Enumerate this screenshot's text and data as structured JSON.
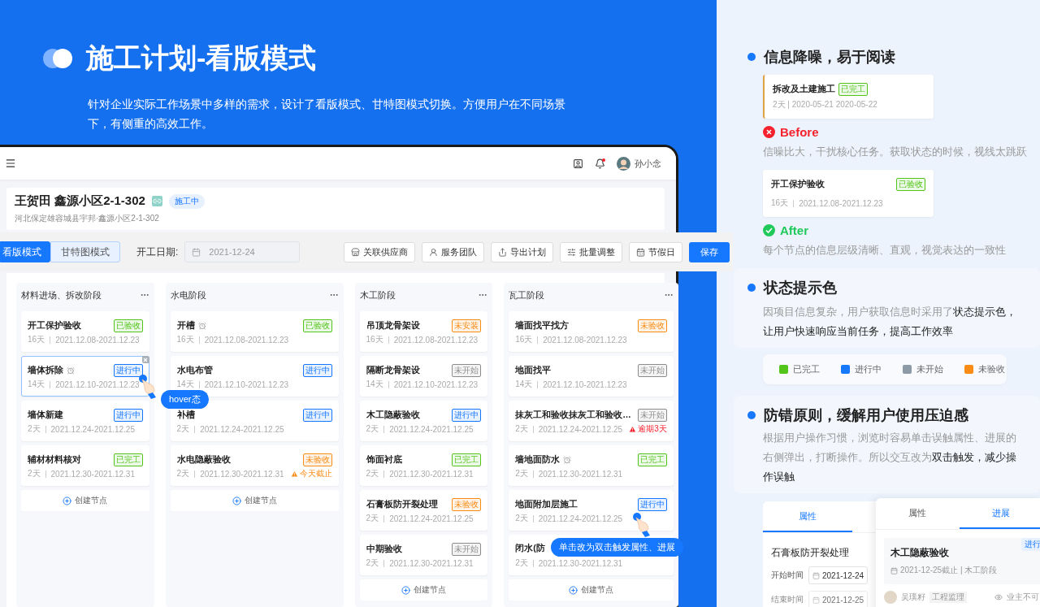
{
  "header": {
    "title": "施工计划-看版模式",
    "description": "针对企业实际工作场景中多样的需求，设计了看版模式、甘特图模式切换。方便用户在不同场景下，有侧重的高效工作。"
  },
  "app": {
    "topbar": {
      "user": "孙小念",
      "notification": true
    },
    "project": {
      "name": "王贺田 鑫源小区2-1-302",
      "status": "施工中",
      "address": "河北保定雄容城县宇邦·鑫源小区2-1-302"
    },
    "view_modes": [
      {
        "label": "看版模式",
        "selected": true
      },
      {
        "label": "甘特图模式",
        "selected": false
      }
    ],
    "start_date": {
      "label": "开工日期:",
      "value": "2021-12-24"
    },
    "actions": [
      {
        "label": "关联供应商"
      },
      {
        "label": "服务团队"
      },
      {
        "label": "导出计划"
      },
      {
        "label": "批量调整"
      },
      {
        "label": "节假日"
      }
    ],
    "save": "保存",
    "columns": [
      {
        "title": "材料进场、拆改阶段",
        "create_label": "创建节点",
        "cards": [
          {
            "title": "开工保护验收",
            "reminder": false,
            "hovered": false,
            "days": "16天",
            "dates": "2021.12.08-2021.12.23",
            "status": {
              "label": "已验收",
              "color": "#52c41a"
            }
          },
          {
            "title": "墙体拆除",
            "reminder": true,
            "hovered": true,
            "days": "14天",
            "dates": "2021.12.10-2021.12.23",
            "status": {
              "label": "进行中",
              "color": "#1677ff"
            },
            "tooltip": {
              "kind": "hover",
              "text": "hover态"
            }
          },
          {
            "title": "墙体新建",
            "reminder": false,
            "hovered": false,
            "days": "2天",
            "dates": "2021.12.24-2021.12.25",
            "status": {
              "label": "进行中",
              "color": "#1677ff"
            }
          },
          {
            "title": "辅材材料核对",
            "reminder": false,
            "hovered": false,
            "days": "2天",
            "dates": "2021.12.30-2021.12.31",
            "status": {
              "label": "已完工",
              "color": "#52c41a"
            }
          }
        ]
      },
      {
        "title": "水电阶段",
        "create_label": "创建节点",
        "cards": [
          {
            "title": "开槽",
            "reminder": true,
            "hovered": false,
            "days": "16天",
            "dates": "2021.12.08-2021.12.23",
            "status": {
              "label": "已验收",
              "color": "#52c41a"
            }
          },
          {
            "title": "水电布管",
            "reminder": false,
            "hovered": false,
            "days": "14天",
            "dates": "2021.12.10-2021.12.23",
            "status": {
              "label": "进行中",
              "color": "#1677ff"
            }
          },
          {
            "title": "补槽",
            "reminder": false,
            "hovered": false,
            "days": "2天",
            "dates": "2021.12.24-2021.12.25",
            "status": {
              "label": "进行中",
              "color": "#1677ff"
            }
          },
          {
            "title": "水电隐蔽验收",
            "reminder": false,
            "hovered": false,
            "days": "2天",
            "dates": "2021.12.30-2021.12.31",
            "status": {
              "label": "未验收",
              "color": "#fa8c16"
            },
            "warning": {
              "text": "今天截止",
              "color": "#fa8c16"
            }
          }
        ]
      },
      {
        "title": "木工阶段",
        "create_label": "创建节点",
        "cards": [
          {
            "title": "吊顶龙骨架设",
            "reminder": false,
            "hovered": false,
            "days": "16天",
            "dates": "2021.12.08-2021.12.23",
            "status": {
              "label": "未安装",
              "color": "#fa8c16"
            }
          },
          {
            "title": "隔断龙骨架设",
            "reminder": false,
            "hovered": false,
            "days": "14天",
            "dates": "2021.12.10-2021.12.23",
            "status": {
              "label": "未开始",
              "color": "#8c8c8c"
            }
          },
          {
            "title": "木工隐蔽验收",
            "reminder": false,
            "hovered": false,
            "days": "2天",
            "dates": "2021.12.24-2021.12.25",
            "status": {
              "label": "进行中",
              "color": "#1677ff"
            }
          },
          {
            "title": "饰面衬底",
            "reminder": false,
            "hovered": false,
            "days": "2天",
            "dates": "2021.12.30-2021.12.31",
            "status": {
              "label": "已完工",
              "color": "#52c41a"
            }
          },
          {
            "title": "石膏板防开裂处理",
            "reminder": false,
            "hovered": false,
            "days": "2天",
            "dates": "2021.12.24-2021.12.25",
            "status": {
              "label": "未验收",
              "color": "#fa8c16"
            }
          },
          {
            "title": "中期验收",
            "reminder": false,
            "hovered": false,
            "days": "2天",
            "dates": "2021.12.30-2021.12.31",
            "status": {
              "label": "未开始",
              "color": "#8c8c8c"
            }
          }
        ]
      },
      {
        "title": "瓦工阶段",
        "create_label": "创建节点",
        "cards": [
          {
            "title": "墙面找平找方",
            "reminder": false,
            "hovered": false,
            "days": "16天",
            "dates": "2021.12.08-2021.12.23",
            "status": {
              "label": "未验收",
              "color": "#fa8c16"
            }
          },
          {
            "title": "地面找平",
            "reminder": false,
            "hovered": false,
            "days": "14天",
            "dates": "2021.12.10-2021.12.23",
            "status": {
              "label": "未开始",
              "color": "#8c8c8c"
            }
          },
          {
            "title": "抹灰工和验收抹灰工和验收…",
            "reminder": false,
            "hovered": false,
            "days": "2天",
            "dates": "2021.12.24-2021.12.25",
            "status": {
              "label": "未开始",
              "color": "#8c8c8c"
            },
            "warning": {
              "text": "逾期3天",
              "color": "#f5222d"
            }
          },
          {
            "title": "墙地面防水",
            "reminder": true,
            "hovered": false,
            "days": "2天",
            "dates": "2021.12.30-2021.12.31",
            "status": {
              "label": "已完工",
              "color": "#52c41a"
            }
          },
          {
            "title": "地面附加层施工",
            "reminder": false,
            "hovered": false,
            "days": "2天",
            "dates": "2021.12.24-2021.12.25",
            "status": {
              "label": "进行中",
              "color": "#1677ff"
            },
            "tooltip": {
              "kind": "click",
              "text": "单击改为双击触发属性、进展"
            }
          },
          {
            "title": "闭水(防",
            "reminder": false,
            "hovered": false,
            "days": "2天",
            "dates": "2021.12.30-2021.12.31"
          }
        ]
      }
    ]
  },
  "noise": {
    "heading": "信息降噪，易于阅读",
    "before": {
      "card": {
        "title": "拆改及土建施工",
        "status": {
          "label": "已完工",
          "color": "#52c41a"
        },
        "meta": "2天 | 2020-05-21 2020-05-22"
      },
      "label": "Before",
      "text": "信噪比大，干扰核心任务。获取状态的时候，视线太跳跃"
    },
    "after": {
      "card": {
        "title": "开工保护验收",
        "status": {
          "label": "已验收",
          "color": "#52c41a"
        },
        "days": "16天",
        "dates": "2021.12.08-2021.12.23"
      },
      "label": "After",
      "text": "每个节点的信息层级清晰、直观，视觉表达的一致性"
    }
  },
  "colors": {
    "heading": "状态提示色",
    "text": "因项目信息复杂，用户获取信息时采用了**状态提示色，让用户快速响应当前任务，提高工作效率**",
    "legend": [
      {
        "label": "已完工",
        "color": "#52c41a"
      },
      {
        "label": "进行中",
        "color": "#1677ff"
      },
      {
        "label": "未开始",
        "color": "#8c9aa8"
      },
      {
        "label": "未验收",
        "color": "#fa8c16"
      }
    ]
  },
  "errors": {
    "heading": "防错原则，缓解用户使用压迫感",
    "text": "根据用户操作习惯，浏览时容易单击误触属性、进展的右侧弹出，打断操作。所以交互改为**双击触发，减少操作误触**",
    "property_panel": {
      "tabs": [
        {
          "label": "属性",
          "selected": true
        }
      ],
      "title": "石膏板防开裂处理",
      "fields": [
        {
          "label": "开始时间",
          "value": "2021-12-24"
        },
        {
          "label": "结束时间",
          "value": "2021-12-25"
        }
      ]
    },
    "progress_panel": {
      "tabs": [
        {
          "label": "属性",
          "selected": false
        },
        {
          "label": "进展",
          "selected": true
        }
      ],
      "task": {
        "title": "木工隐蔽验收",
        "status": "进行",
        "meta": "2021-12-25截止 | 木工阶段"
      },
      "comment": {
        "author": "吴璞籽",
        "role": "工程监理",
        "visibility": "业主不可"
      }
    }
  }
}
